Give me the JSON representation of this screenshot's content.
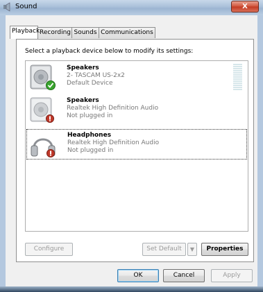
{
  "window": {
    "title": "Sound",
    "close_label": "X"
  },
  "tabs": [
    {
      "label": "Playback",
      "active": true
    },
    {
      "label": "Recording",
      "active": false
    },
    {
      "label": "Sounds",
      "active": false
    },
    {
      "label": "Communications",
      "active": false
    }
  ],
  "instruction": "Select a playback device below to modify its settings:",
  "devices": [
    {
      "name": "Speakers",
      "line2": "2- TASCAM US-2x2",
      "line3": "Default Device",
      "icon": "speaker-icon",
      "status_icon": "check-badge-icon",
      "selected": false
    },
    {
      "name": "Speakers",
      "line2": "Realtek High Definition Audio",
      "line3": "Not plugged in",
      "icon": "speaker-icon",
      "status_icon": "unplugged-badge-icon",
      "selected": false
    },
    {
      "name": "Headphones",
      "line2": "Realtek High Definition Audio",
      "line3": "Not plugged in",
      "icon": "headphones-icon",
      "status_icon": "unplugged-badge-icon",
      "selected": true
    }
  ],
  "buttons": {
    "configure": "Configure",
    "set_default": "Set Default",
    "properties": "Properties",
    "ok": "OK",
    "cancel": "Cancel",
    "apply": "Apply"
  },
  "colors": {
    "check_badge": "#3aa52f",
    "unplugged_badge": "#c0392b",
    "default_button_border": "#3c7fb1"
  }
}
